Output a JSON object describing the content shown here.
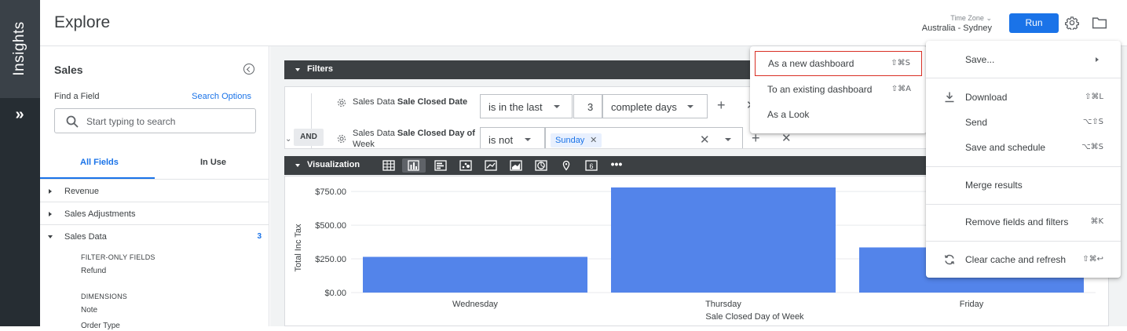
{
  "rail": {
    "brand": "Insights",
    "expand_glyph": "»"
  },
  "header": {
    "title": "Explore",
    "timezone_label": "Time Zone",
    "timezone_value": "Australia - Sydney",
    "run_label": "Run"
  },
  "field_panel": {
    "title": "Sales",
    "find_label": "Find a Field",
    "search_options": "Search Options",
    "search_placeholder": "Start typing to search",
    "tabs": [
      "All Fields",
      "In Use"
    ],
    "views": [
      {
        "label": "Revenue",
        "count": ""
      },
      {
        "label": "Sales Adjustments",
        "count": ""
      },
      {
        "label": "Sales Data",
        "count": "3"
      }
    ],
    "sub_items": {
      "filter_only_header": "FILTER-ONLY FIELDS",
      "refund": "Refund",
      "dimensions_header": "DIMENSIONS",
      "note": "Note",
      "order_type": "Order Type"
    }
  },
  "filters": {
    "bar_label": "Filters",
    "and_label": "AND",
    "rows": [
      {
        "view": "Sales Data ",
        "field": "Sale Closed Date",
        "operator": "is in the last",
        "value": "3",
        "unit": "complete days"
      },
      {
        "view": "Sales Data ",
        "field": "Sale Closed Day of",
        "field_line2": "Week",
        "operator": "is not",
        "chip": "Sunday"
      }
    ]
  },
  "visualization": {
    "bar_label": "Visualization"
  },
  "chart_data": {
    "type": "bar",
    "categories": [
      "Wednesday",
      "Thursday",
      "Friday"
    ],
    "values": [
      265,
      780,
      335
    ],
    "xlabel": "Sale Closed Day of Week",
    "ylabel": "Total Inc Tax",
    "yticks": [
      "$0.00",
      "$250.00",
      "$500.00",
      "$750.00"
    ],
    "ytick_values": [
      0,
      250,
      500,
      750
    ],
    "ylim": [
      0,
      780
    ],
    "bar_color": "#5384ea",
    "grid": true
  },
  "gear_menu": {
    "items": [
      {
        "label": "Save...",
        "shortcut": "",
        "icon": "",
        "submenu": true
      },
      {
        "label": "Download",
        "shortcut": "⇧⌘L",
        "icon": "download-icon"
      },
      {
        "label": "Send",
        "shortcut": "⌥⇧S",
        "icon": ""
      },
      {
        "label": "Save and schedule",
        "shortcut": "⌥⌘S",
        "icon": ""
      },
      {
        "label": "Merge results",
        "shortcut": "",
        "icon": ""
      },
      {
        "label": "Remove fields and filters",
        "shortcut": "⌘K",
        "icon": ""
      },
      {
        "label": "Clear cache and refresh",
        "shortcut": "⇧⌘↩",
        "icon": "refresh-icon"
      }
    ]
  },
  "save_submenu": {
    "items": [
      {
        "label": "As a new dashboard",
        "shortcut": "⇧⌘S"
      },
      {
        "label": "To an existing dashboard",
        "shortcut": "⇧⌘A"
      },
      {
        "label": "As a Look",
        "shortcut": ""
      }
    ]
  }
}
